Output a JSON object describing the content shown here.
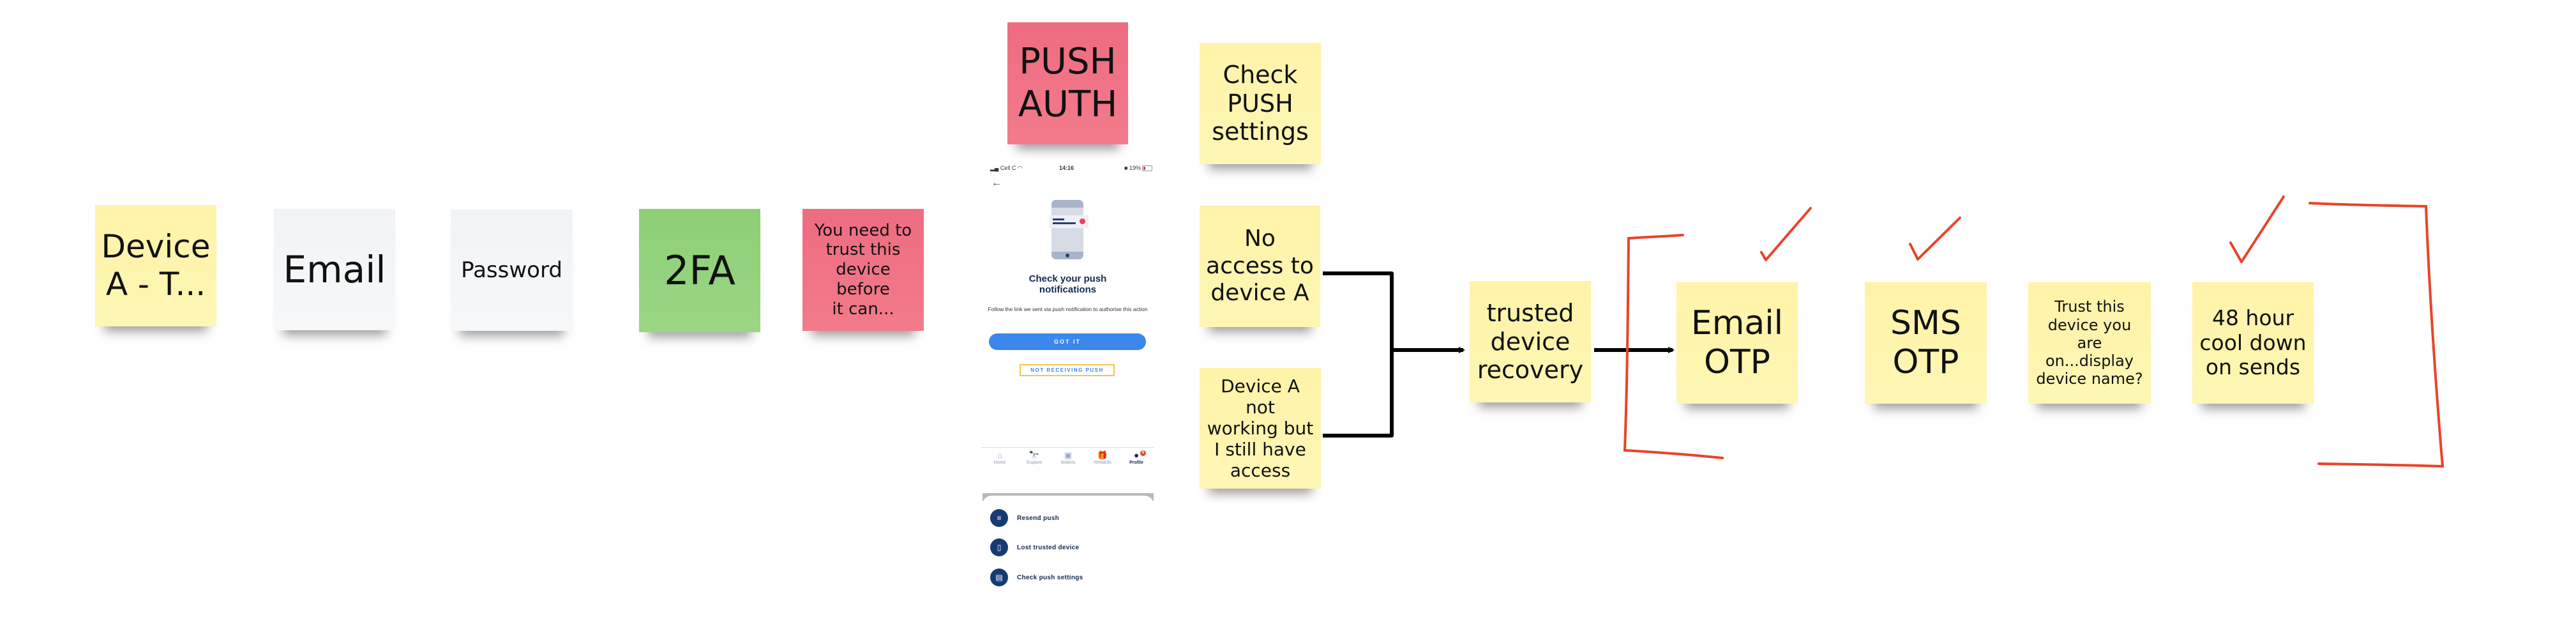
{
  "board": {
    "notes": {
      "device_a": "Device\nA - T...",
      "email": "Email",
      "password": "Password",
      "two_fa": "2FA",
      "trust_before": "You need to\ntrust this\ndevice before\nit can...",
      "push_auth": "PUSH\nAUTH",
      "check_push_settings": "Check\nPUSH\nsettings",
      "no_access": "No\naccess to\ndevice A",
      "not_working": "Device A not\nworking but\nI still have\naccess",
      "trusted_recovery": "trusted\ndevice\nrecovery",
      "email_otp": "Email\nOTP",
      "sms_otp": "SMS\nOTP",
      "trust_this_device": "Trust this\ndevice you are\non...display\ndevice name?",
      "cooldown": "48 hour\ncool down\non sends"
    },
    "colors": {
      "yellow": "#FEF5AE",
      "white": "#F3F5F8",
      "green": "#93D27D",
      "pink": "#F07385",
      "annotation_red": "#E8442A",
      "connector": "#000000"
    }
  },
  "phone": {
    "status": {
      "carrier": "Cell C",
      "time": "14:16",
      "battery": "19%"
    },
    "back_icon": "←",
    "title": "Check your push\nnotifications",
    "subtitle": "Follow the link we sent via push notification to authorise this action",
    "primary_button": "GOT IT",
    "secondary_button": "NOT RECEIVING PUSH",
    "tabs": [
      {
        "label": "Home",
        "icon": "⌂"
      },
      {
        "label": "Explore",
        "icon": "🔭"
      },
      {
        "label": "Wallets",
        "icon": "▣"
      },
      {
        "label": "Rewards",
        "icon": "🎁"
      },
      {
        "label": "Profile",
        "icon": "●",
        "badge": "6"
      }
    ],
    "sheet_items": [
      {
        "label": "Resend push",
        "icon": "≡"
      },
      {
        "label": "Lost trusted device",
        "icon": "▯"
      },
      {
        "label": "Check push settings",
        "icon": "▤"
      }
    ]
  }
}
